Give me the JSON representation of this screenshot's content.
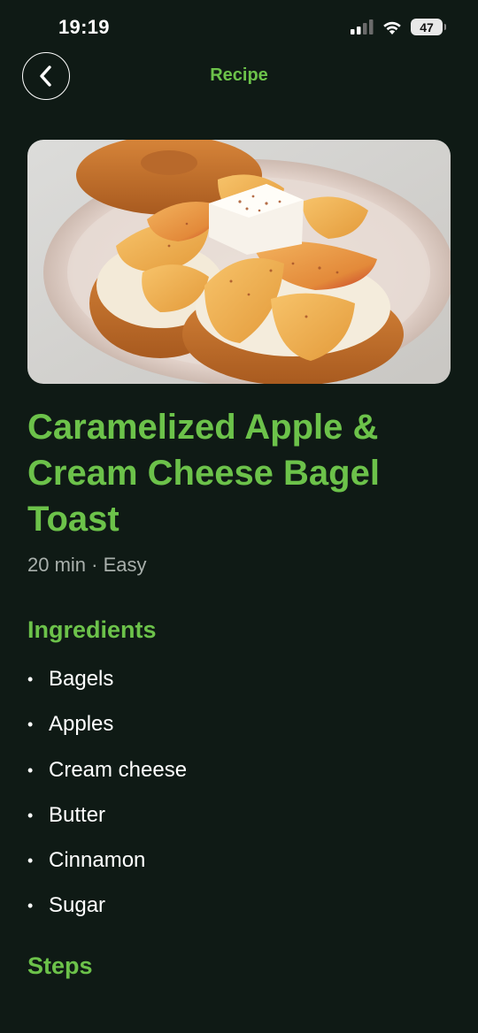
{
  "status_bar": {
    "time": "19:19",
    "battery": "47"
  },
  "header": {
    "title": "Recipe"
  },
  "recipe": {
    "title": "Caramelized Apple & Cream Cheese Bagel Toast",
    "meta": "20 min · Easy"
  },
  "ingredients": {
    "heading": "Ingredients",
    "items": [
      "Bagels",
      "Apples",
      "Cream cheese",
      "Butter",
      "Cinnamon",
      "Sugar"
    ]
  },
  "steps": {
    "heading": "Steps"
  },
  "icons": {
    "back": "chevron-left-icon",
    "signal": "cellular-signal-icon",
    "wifi": "wifi-icon",
    "battery": "battery-icon"
  },
  "colors": {
    "background": "#0f1a15",
    "accent": "#6cc24a",
    "text": "#ffffff",
    "muted": "#a9b0ac"
  }
}
